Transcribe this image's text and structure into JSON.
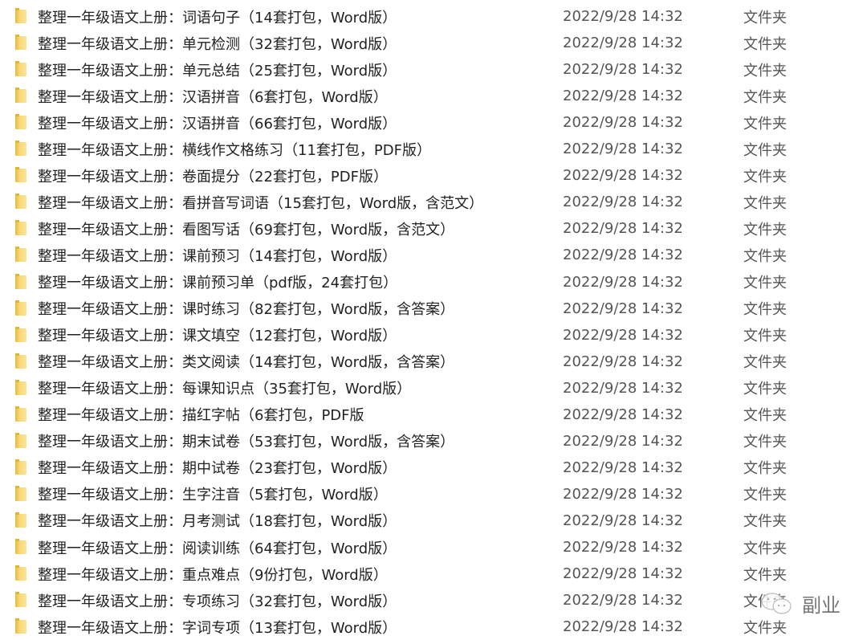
{
  "files": [
    {
      "name": "整理一年级语文上册：词语句子（14套打包，Word版）",
      "date": "2022/9/28 14:32",
      "type": "文件夹"
    },
    {
      "name": "整理一年级语文上册：单元检测（32套打包，Word版）",
      "date": "2022/9/28 14:32",
      "type": "文件夹"
    },
    {
      "name": "整理一年级语文上册：单元总结（25套打包，Word版）",
      "date": "2022/9/28 14:32",
      "type": "文件夹"
    },
    {
      "name": "整理一年级语文上册：汉语拼音（6套打包，Word版）",
      "date": "2022/9/28 14:32",
      "type": "文件夹"
    },
    {
      "name": "整理一年级语文上册：汉语拼音（66套打包，Word版）",
      "date": "2022/9/28 14:32",
      "type": "文件夹"
    },
    {
      "name": "整理一年级语文上册：横线作文格练习（11套打包，PDF版）",
      "date": "2022/9/28 14:32",
      "type": "文件夹"
    },
    {
      "name": "整理一年级语文上册：卷面提分（22套打包，PDF版）",
      "date": "2022/9/28 14:32",
      "type": "文件夹"
    },
    {
      "name": "整理一年级语文上册：看拼音写词语（15套打包，Word版，含范文）",
      "date": "2022/9/28 14:32",
      "type": "文件夹"
    },
    {
      "name": "整理一年级语文上册：看图写话（69套打包，Word版，含范文）",
      "date": "2022/9/28 14:32",
      "type": "文件夹"
    },
    {
      "name": "整理一年级语文上册：课前预习（14套打包，Word版）",
      "date": "2022/9/28 14:32",
      "type": "文件夹"
    },
    {
      "name": "整理一年级语文上册：课前预习单（pdf版，24套打包）",
      "date": "2022/9/28 14:32",
      "type": "文件夹"
    },
    {
      "name": "整理一年级语文上册：课时练习（82套打包，Word版，含答案）",
      "date": "2022/9/28 14:32",
      "type": "文件夹"
    },
    {
      "name": "整理一年级语文上册：课文填空（12套打包，Word版）",
      "date": "2022/9/28 14:32",
      "type": "文件夹"
    },
    {
      "name": "整理一年级语文上册：类文阅读（14套打包，Word版，含答案）",
      "date": "2022/9/28 14:32",
      "type": "文件夹"
    },
    {
      "name": "整理一年级语文上册：每课知识点（35套打包，Word版）",
      "date": "2022/9/28 14:32",
      "type": "文件夹"
    },
    {
      "name": "整理一年级语文上册：描红字帖（6套打包，PDF版",
      "date": "2022/9/28 14:32",
      "type": "文件夹"
    },
    {
      "name": "整理一年级语文上册：期末试卷（53套打包，Word版，含答案）",
      "date": "2022/9/28 14:32",
      "type": "文件夹"
    },
    {
      "name": "整理一年级语文上册：期中试卷（23套打包，Word版）",
      "date": "2022/9/28 14:32",
      "type": "文件夹"
    },
    {
      "name": "整理一年级语文上册：生字注音（5套打包，Word版）",
      "date": "2022/9/28 14:32",
      "type": "文件夹"
    },
    {
      "name": "整理一年级语文上册：月考测试（18套打包，Word版）",
      "date": "2022/9/28 14:32",
      "type": "文件夹"
    },
    {
      "name": "整理一年级语文上册：阅读训练（64套打包，Word版）",
      "date": "2022/9/28 14:32",
      "type": "文件夹"
    },
    {
      "name": "整理一年级语文上册：重点难点（9份打包，Word版）",
      "date": "2022/9/28 14:32",
      "type": "文件夹"
    },
    {
      "name": "整理一年级语文上册：专项练习（32套打包，Word版）",
      "date": "2022/9/28 14:32",
      "type": "文件夹"
    },
    {
      "name": "整理一年级语文上册：字词专项（13套打包，Word版）",
      "date": "2022/9/28 14:32",
      "type": "文件夹"
    }
  ],
  "watermark": {
    "text": "副业",
    "icon": "wechat-icon"
  }
}
